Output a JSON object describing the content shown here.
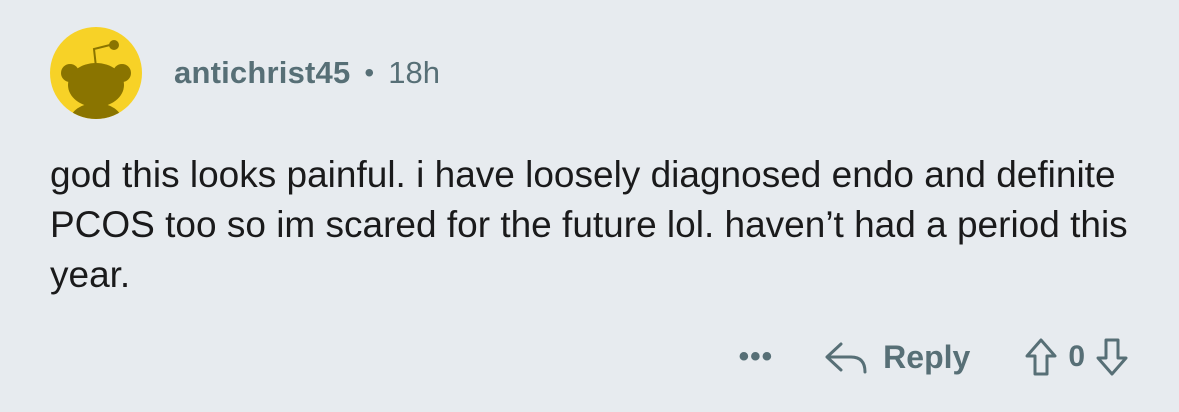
{
  "comment": {
    "username": "antichrist45",
    "separator": "•",
    "time": "18h",
    "body": "god this looks painful. i have loosely diagnosed endo and definite PCOS too so im scared for the future lol. haven’t had a period this year."
  },
  "actions": {
    "more_label": "•••",
    "reply_label": "Reply",
    "score": "0"
  },
  "icons": {
    "avatar": "snoo-avatar-icon",
    "reply": "reply-arrow-icon",
    "upvote": "upvote-arrow-icon",
    "downvote": "downvote-arrow-icon"
  },
  "colors": {
    "background": "#e7ebef",
    "avatar_bg": "#f7d227",
    "meta_text": "#576f76",
    "body_text": "#1a1a1b"
  }
}
